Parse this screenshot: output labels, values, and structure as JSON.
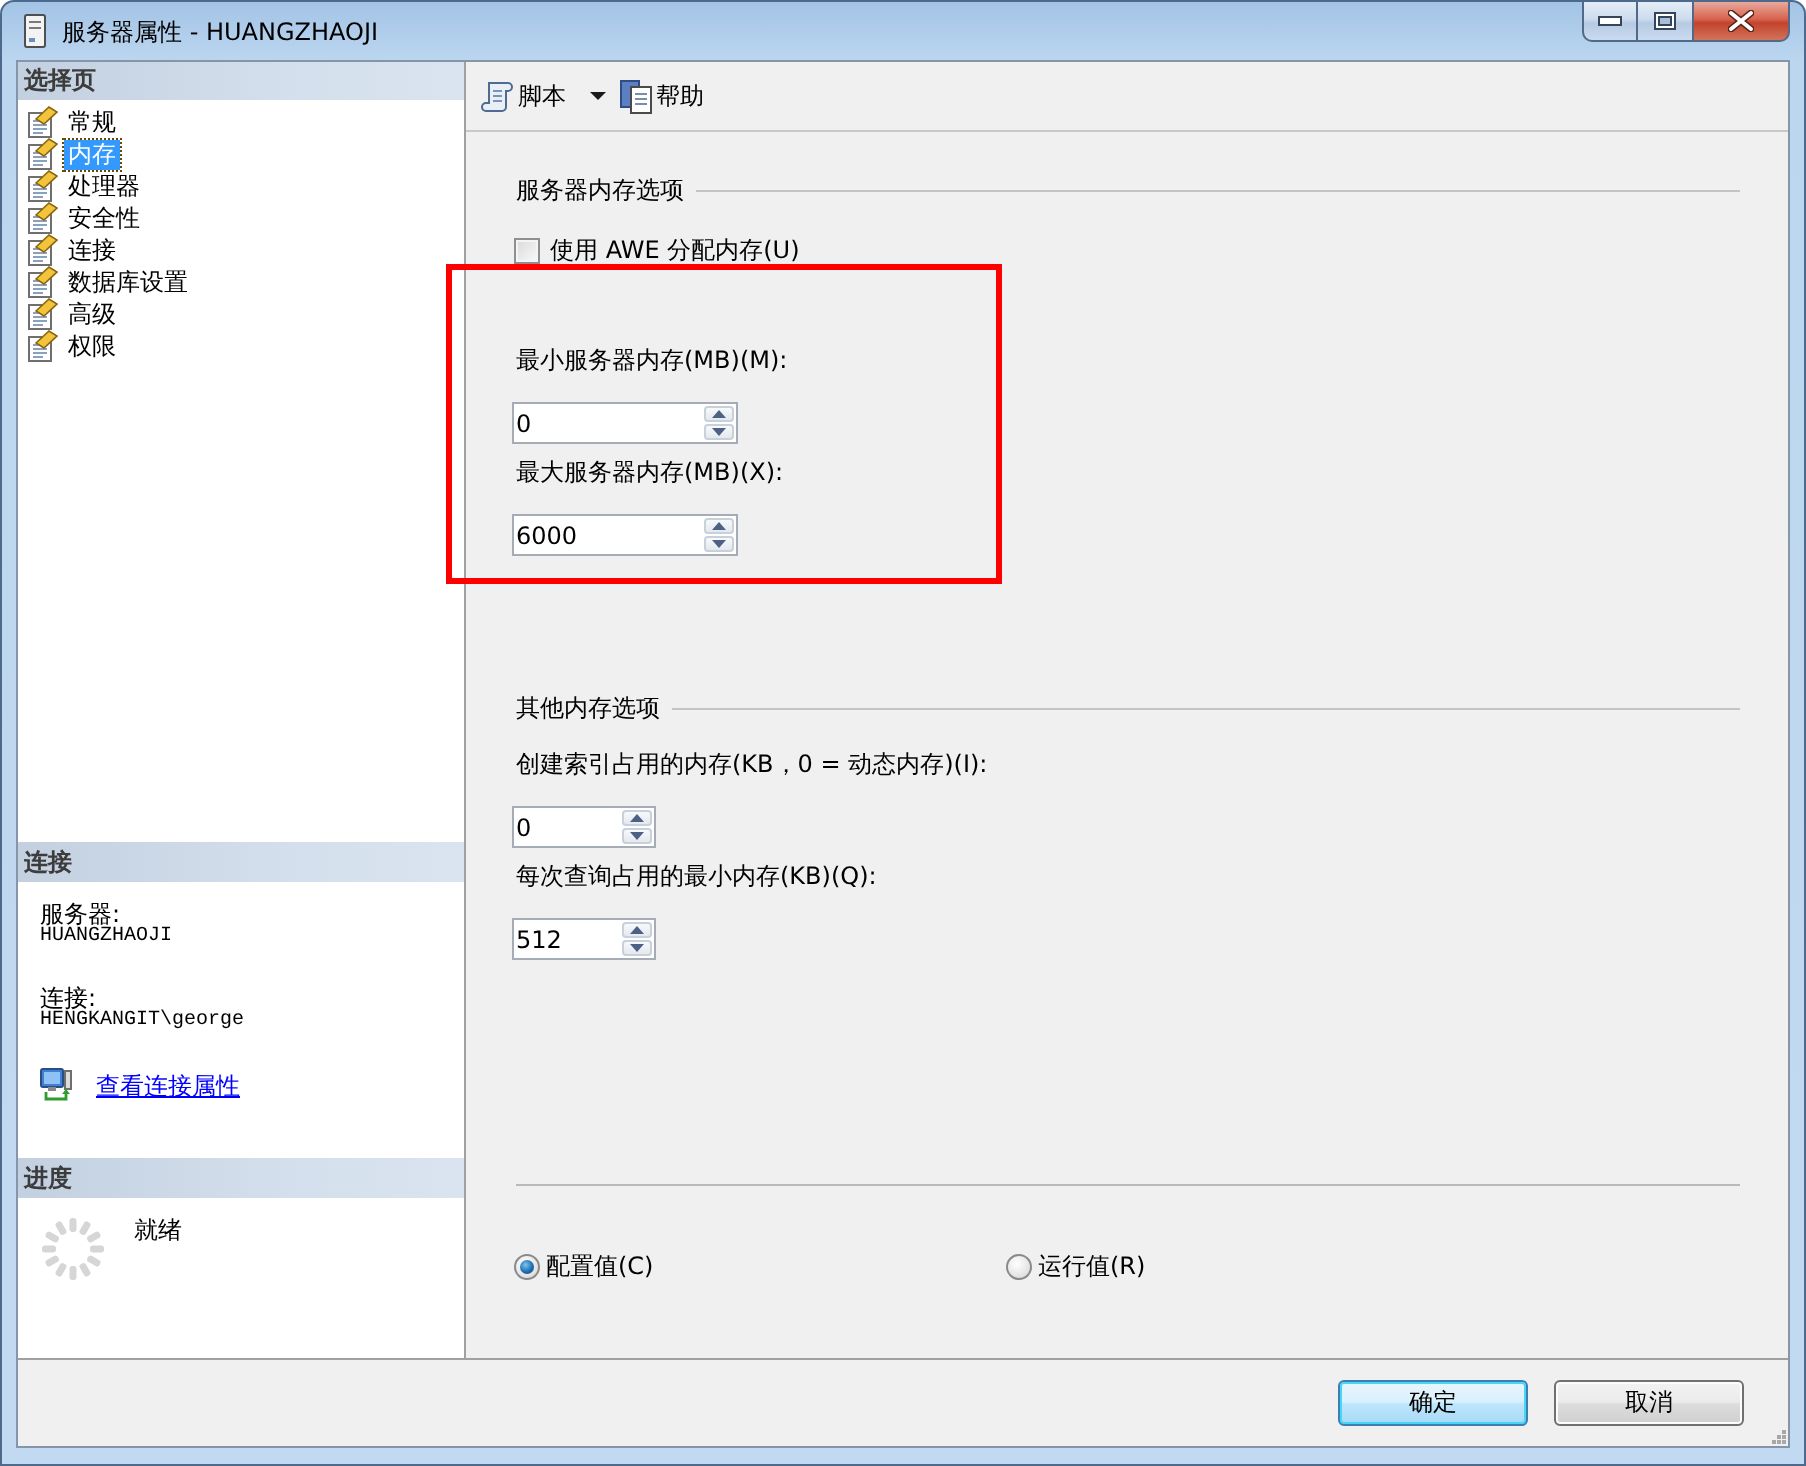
{
  "window": {
    "title": "服务器属性 - HUANGZHAOJI"
  },
  "sidebar": {
    "pages_header": "选择页",
    "pages": [
      {
        "label": "常规",
        "selected": false
      },
      {
        "label": "内存",
        "selected": true
      },
      {
        "label": "处理器",
        "selected": false
      },
      {
        "label": "安全性",
        "selected": false
      },
      {
        "label": "连接",
        "selected": false
      },
      {
        "label": "数据库设置",
        "selected": false
      },
      {
        "label": "高级",
        "selected": false
      },
      {
        "label": "权限",
        "selected": false
      }
    ],
    "connection": {
      "header": "连接",
      "server_label": "服务器:",
      "server": "HUANGZHAOJI",
      "connection_label": "连接:",
      "connection": "HENGKANGIT\\george",
      "link": "查看连接属性"
    },
    "progress": {
      "header": "进度",
      "status": "就绪"
    }
  },
  "toolbar": [
    {
      "kind": "dropdown",
      "label": "脚本"
    },
    {
      "kind": "button",
      "label": "帮助"
    }
  ],
  "sections": [
    {
      "title": "服务器内存选项",
      "checkbox": {
        "label": "使用 AWE 分配内存(U)",
        "checked": false
      },
      "highlighted": true,
      "fields": [
        {
          "label": "最小服务器内存(MB)(M):",
          "value": "0"
        },
        {
          "label": "最大服务器内存(MB)(X):",
          "value": "6000"
        }
      ]
    },
    {
      "title": "其他内存选项",
      "fields": [
        {
          "label": "创建索引占用的内存(KB，0 = 动态内存)(I):",
          "value": "0"
        },
        {
          "label": "每次查询占用的最小内存(KB)(Q):",
          "value": "512"
        }
      ]
    }
  ],
  "value_source": [
    {
      "label": "配置值(C)",
      "selected": true
    },
    {
      "label": "运行值(R)",
      "selected": false
    }
  ],
  "buttons": [
    {
      "kind": "default",
      "label": "确定"
    },
    {
      "kind": "normal",
      "label": "取消"
    }
  ]
}
